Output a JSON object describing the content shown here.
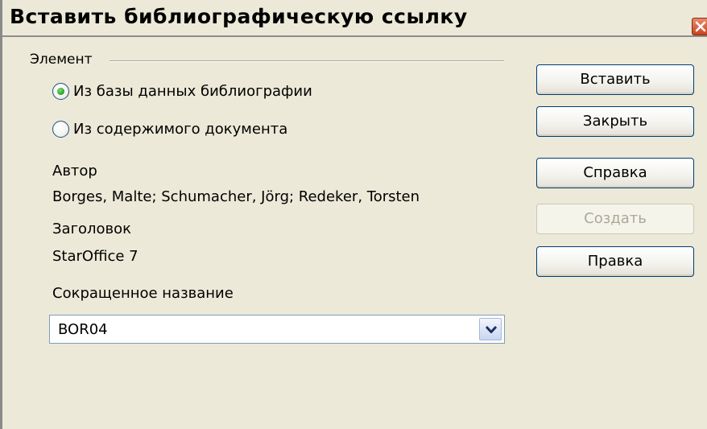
{
  "dialog": {
    "title": "Вставить библиографическую ссылку"
  },
  "element_group": {
    "label": "Элемент",
    "options": [
      {
        "label": "Из базы данных библиографии",
        "selected": true
      },
      {
        "label": "Из содержимого документа",
        "selected": false
      }
    ]
  },
  "fields": {
    "author_label": "Автор",
    "author_value": "Borges, Malte; Schumacher, Jörg; Redeker, Torsten",
    "title_label": "Заголовок",
    "title_value": "StarOffice 7",
    "short_name_label": "Сокращенное название",
    "short_name_value": "BOR04"
  },
  "buttons": {
    "insert": "Вставить",
    "close": "Закрыть",
    "help": "Справка",
    "create": "Создать",
    "edit": "Правка"
  },
  "colors": {
    "dialog_background": "#ece9d8",
    "button_border": "#003c74",
    "disabled_text": "#aca899",
    "close_button": "#c7451f",
    "radio_selected": "#2fa52a"
  },
  "icons": {
    "close": "close-x-icon",
    "dropdown": "chevron-down-icon"
  }
}
